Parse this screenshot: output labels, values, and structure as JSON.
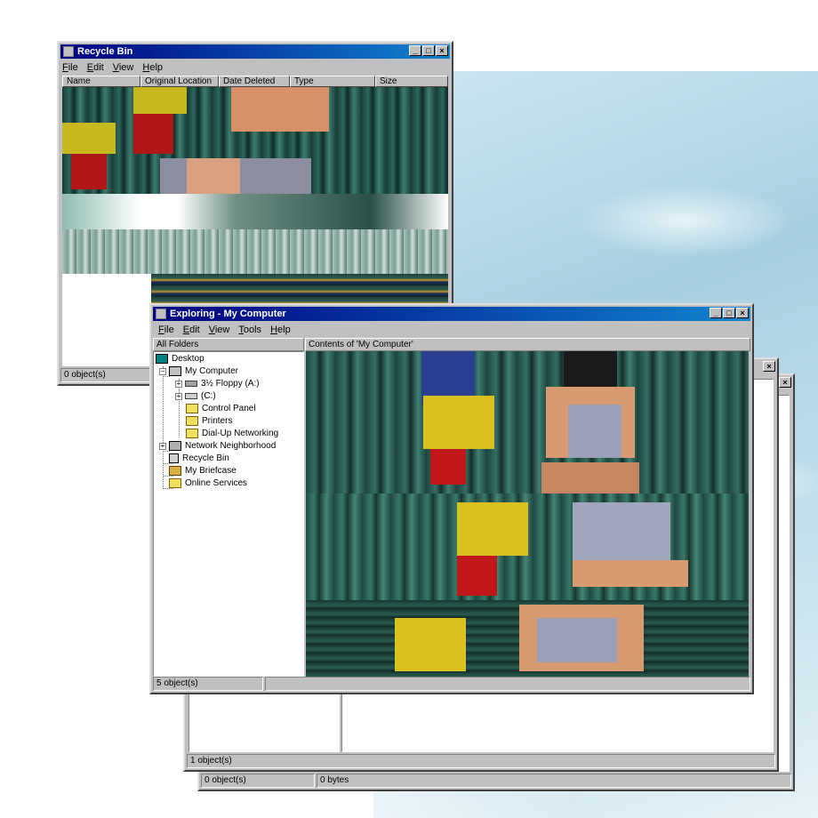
{
  "recycle_bin": {
    "title": "Recycle Bin",
    "menu": [
      "File",
      "Edit",
      "View",
      "Help"
    ],
    "columns": [
      "Name",
      "Original Location",
      "Date Deleted",
      "Type",
      "Size"
    ],
    "status": "0 object(s)"
  },
  "explorer": {
    "title": "Exploring - My Computer",
    "menu": [
      "File",
      "Edit",
      "View",
      "Tools",
      "Help"
    ],
    "left_header": "All Folders",
    "right_header": "Contents of 'My Computer'",
    "tree": {
      "desktop": "Desktop",
      "my_computer": "My Computer",
      "floppy": "3½ Floppy (A:)",
      "c_drive": "(C:)",
      "control_panel": "Control Panel",
      "printers": "Printers",
      "dialup": "Dial-Up Networking",
      "network": "Network Neighborhood",
      "recycle": "Recycle Bin",
      "briefcase": "My Briefcase",
      "online": "Online Services"
    },
    "status": "5 object(s)"
  },
  "back_window_1": {
    "status": "1 object(s)"
  },
  "back_window_2": {
    "status_left": "0 object(s)",
    "status_right": "0 bytes"
  },
  "colors": {
    "title_active": "#000080",
    "title_gradient_end": "#1084d0",
    "face": "#c0c0c0"
  }
}
